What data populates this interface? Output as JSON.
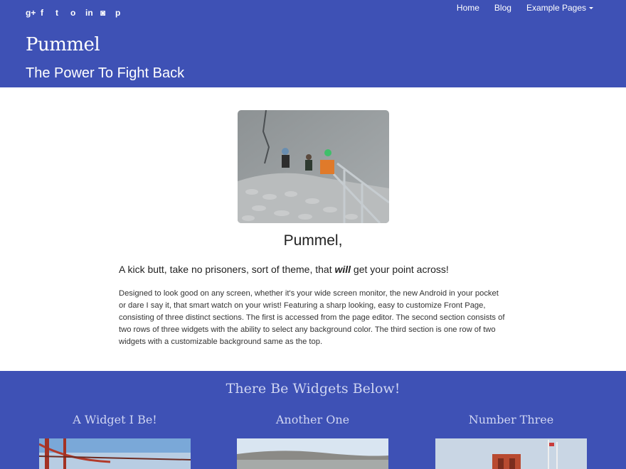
{
  "header": {
    "social": [
      {
        "icon": "google-plus-icon",
        "glyph": "g+"
      },
      {
        "icon": "facebook-icon",
        "glyph": "f"
      },
      {
        "icon": "twitter-icon",
        "glyph": "t"
      },
      {
        "icon": "github-icon",
        "glyph": "o"
      },
      {
        "icon": "linkedin-icon",
        "glyph": "in"
      },
      {
        "icon": "instagram-icon",
        "glyph": "◙"
      },
      {
        "icon": "pinterest-icon",
        "glyph": "p"
      }
    ],
    "nav": {
      "home": "Home",
      "blog": "Blog",
      "pages": "Example Pages"
    },
    "site_title": "Pummel",
    "tagline": "The Power To Fight Back"
  },
  "hero": {
    "title": "Pummel,",
    "lead_start": "A kick butt, take no prisoners, sort of theme, that ",
    "lead_em": "will",
    "lead_end": " get your point across!",
    "body": "Designed to look good on any screen, whether it's your wide screen monitor, the new Android in your pocket or dare I say it, that smart watch on your wrist! Featuring a sharp looking, easy to customize Front Page, consisting of three distinct sections. The first is accessed from the page editor. The second section consists of two rows of three widgets with the ability to select any background color. The third section is one row of two widgets with a customizable background  same as the top."
  },
  "widgets": {
    "title": "There Be Widgets Below!",
    "items": [
      {
        "title": "A Widget I Be!"
      },
      {
        "title": "Another One"
      },
      {
        "title": "Number Three"
      }
    ]
  },
  "colors": {
    "brand": "#3e51b5",
    "widget_text": "#cfd5f2"
  }
}
